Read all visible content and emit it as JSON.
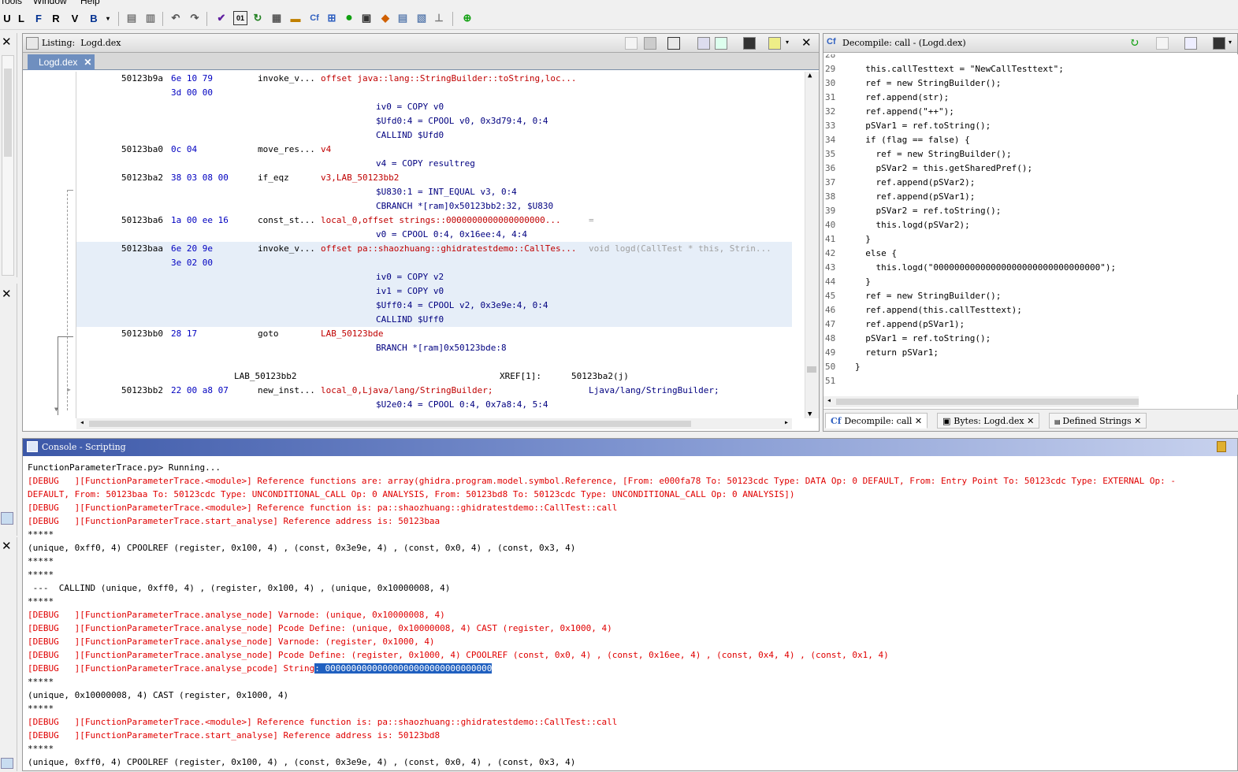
{
  "menu": {
    "items": [
      "Tools",
      "Window",
      "Help"
    ]
  },
  "listing": {
    "title": "Listing:",
    "file": "Logd.dex",
    "tab": "Logd.dex",
    "rows": [
      {
        "addr": "50123b9a",
        "bytes": "6e 10 79",
        "mnem": "invoke_v...",
        "ops": "offset java::lang::StringBuilder::toString,loc..."
      },
      {
        "bytes": "3d 00 00"
      },
      {
        "pcode": "iv0 = COPY v0"
      },
      {
        "pcode": "$Ufd0:4 = CPOOL v0, 0x3d79:4, 0:4"
      },
      {
        "pcode": "CALLIND $Ufd0"
      },
      {
        "addr": "50123ba0",
        "bytes": "0c 04",
        "mnem": "move_res...",
        "ops": "v4"
      },
      {
        "pcode": "v4 = COPY resultreg"
      },
      {
        "addr": "50123ba2",
        "bytes": "38 03 08 00",
        "mnem": "if_eqz",
        "ops": "v3,LAB_50123bb2"
      },
      {
        "pcode": "$U830:1 = INT_EQUAL v3, 0:4"
      },
      {
        "pcode": "CBRANCH *[ram]0x50123bb2:32, $U830"
      },
      {
        "addr": "50123ba6",
        "bytes": "1a 00 ee 16",
        "mnem": "const_st...",
        "ops": "local_0,offset strings::0000000000000000000...",
        "extra": "="
      },
      {
        "pcode": "v0 = CPOOL 0:4, 0x16ee:4, 4:4"
      },
      {
        "addr": "50123baa",
        "bytes": "6e 20 9e",
        "mnem": "invoke_v...",
        "ops": "offset pa::shaozhuang::ghidratestdemo::CallTes...",
        "extra": "void logd(CallTest * this, Strin..."
      },
      {
        "bytes": "3e 02 00"
      },
      {
        "pcode": "iv0 = COPY v2"
      },
      {
        "pcode": "iv1 = COPY v0"
      },
      {
        "pcode": "$Uff0:4 = CPOOL v2, 0x3e9e:4, 0:4"
      },
      {
        "pcode": "CALLIND $Uff0"
      },
      {
        "addr": "50123bb0",
        "bytes": "28 17",
        "mnem": "goto",
        "ops": "LAB_50123bde"
      },
      {
        "pcode": "BRANCH *[ram]0x50123bde:8"
      },
      {},
      {
        "label": "LAB_50123bb2",
        "xref": "XREF[1]:",
        "xrefaddr": "50123ba2(j)"
      },
      {
        "addr": "50123bb2",
        "bytes": "22 00 a8 07",
        "mnem": "new_inst...",
        "ops": "local_0,Ljava/lang/StringBuilder;",
        "extra": "Ljava/lang/StringBuilder;"
      },
      {
        "pcode": "$U2e0:4 = CPOOL 0:4, 0x7a8:4, 5:4"
      }
    ]
  },
  "decompile": {
    "title": "Decompile: call -  (Logd.dex)",
    "lines": [
      {
        "n": "28",
        "t": ""
      },
      {
        "n": "29",
        "t": "  this.callTesttext = \"NewCallTesttext\";"
      },
      {
        "n": "30",
        "t": "  ref = new StringBuilder();"
      },
      {
        "n": "31",
        "t": "  ref.append(str);"
      },
      {
        "n": "32",
        "t": "  ref.append(\"++\");"
      },
      {
        "n": "33",
        "t": "  pSVar1 = ref.toString();"
      },
      {
        "n": "34",
        "t": "  if (flag == false) {"
      },
      {
        "n": "35",
        "t": "    ref = new StringBuilder();"
      },
      {
        "n": "36",
        "t": "    pSVar2 = this.getSharedPref();"
      },
      {
        "n": "37",
        "t": "    ref.append(pSVar2);"
      },
      {
        "n": "38",
        "t": "    ref.append(pSVar1);"
      },
      {
        "n": "39",
        "t": "    pSVar2 = ref.toString();"
      },
      {
        "n": "40",
        "t": "    this.logd(pSVar2);"
      },
      {
        "n": "41",
        "t": "  }"
      },
      {
        "n": "42",
        "t": "  else {"
      },
      {
        "n": "43",
        "t": "    this.logd(\"00000000000000000000000000000000\");"
      },
      {
        "n": "44",
        "t": "  }"
      },
      {
        "n": "45",
        "t": "  ref = new StringBuilder();"
      },
      {
        "n": "46",
        "t": "  ref.append(this.callTesttext);"
      },
      {
        "n": "47",
        "t": "  ref.append(pSVar1);"
      },
      {
        "n": "48",
        "t": "  pSVar1 = ref.toString();"
      },
      {
        "n": "49",
        "t": "  return pSVar1;"
      },
      {
        "n": "50",
        "t": "}"
      },
      {
        "n": "51",
        "t": ""
      }
    ],
    "tabs": [
      "Decompile: call",
      "Bytes: Logd.dex",
      "Defined Strings"
    ]
  },
  "console": {
    "title": "Console - Scripting",
    "lines": [
      {
        "c": "blk",
        "t": "FunctionParameterTrace.py> Running..."
      },
      {
        "c": "red",
        "t": "[DEBUG   ][FunctionParameterTrace.<module>] Reference functions are: array(ghidra.program.model.symbol.Reference, [From: e000fa78 To: 50123cdc Type: DATA Op: 0 DEFAULT, From: Entry Point To: 50123cdc Type: EXTERNAL Op: -"
      },
      {
        "c": "red",
        "t": "DEFAULT, From: 50123baa To: 50123cdc Type: UNCONDITIONAL_CALL Op: 0 ANALYSIS, From: 50123bd8 To: 50123cdc Type: UNCONDITIONAL_CALL Op: 0 ANALYSIS])"
      },
      {
        "c": "red",
        "t": "[DEBUG   ][FunctionParameterTrace.<module>] Reference function is: pa::shaozhuang::ghidratestdemo::CallTest::call"
      },
      {
        "c": "red",
        "t": "[DEBUG   ][FunctionParameterTrace.start_analyse] Reference address is: 50123baa"
      },
      {
        "c": "blk",
        "t": "*****"
      },
      {
        "c": "blk",
        "t": "(unique, 0xff0, 4) CPOOLREF (register, 0x100, 4) , (const, 0x3e9e, 4) , (const, 0x0, 4) , (const, 0x3, 4)"
      },
      {
        "c": "blk",
        "t": "*****"
      },
      {
        "c": "blk",
        "t": "*****"
      },
      {
        "c": "blk",
        "t": " ---  CALLIND (unique, 0xff0, 4) , (register, 0x100, 4) , (unique, 0x10000008, 4)"
      },
      {
        "c": "blk",
        "t": "*****"
      },
      {
        "c": "red",
        "t": "[DEBUG   ][FunctionParameterTrace.analyse_node] Varnode: (unique, 0x10000008, 4)"
      },
      {
        "c": "red",
        "t": "[DEBUG   ][FunctionParameterTrace.analyse_node] Pcode Define: (unique, 0x10000008, 4) CAST (register, 0x1000, 4)"
      },
      {
        "c": "red",
        "t": "[DEBUG   ][FunctionParameterTrace.analyse_node] Varnode: (register, 0x1000, 4)"
      },
      {
        "c": "red",
        "t": "[DEBUG   ][FunctionParameterTrace.analyse_node] Pcode Define: (register, 0x1000, 4) CPOOLREF (const, 0x0, 4) , (const, 0x16ee, 4) , (const, 0x4, 4) , (const, 0x1, 4)"
      },
      {
        "c": "red",
        "t": "[DEBUG   ][FunctionParameterTrace.analyse_pcode] String",
        "sel": ": 00000000000000000000000000000000"
      },
      {
        "c": "blk",
        "t": "*****"
      },
      {
        "c": "blk",
        "t": "(unique, 0x10000008, 4) CAST (register, 0x1000, 4)"
      },
      {
        "c": "blk",
        "t": "*****"
      },
      {
        "c": "red",
        "t": "[DEBUG   ][FunctionParameterTrace.<module>] Reference function is: pa::shaozhuang::ghidratestdemo::CallTest::call"
      },
      {
        "c": "red",
        "t": "[DEBUG   ][FunctionParameterTrace.start_analyse] Reference address is: 50123bd8"
      },
      {
        "c": "blk",
        "t": "*****"
      },
      {
        "c": "blk",
        "t": "(unique, 0xff0, 4) CPOOLREF (register, 0x100, 4) , (const, 0x3e9e, 4) , (const, 0x0, 4) , (const, 0x3, 4)"
      }
    ]
  }
}
